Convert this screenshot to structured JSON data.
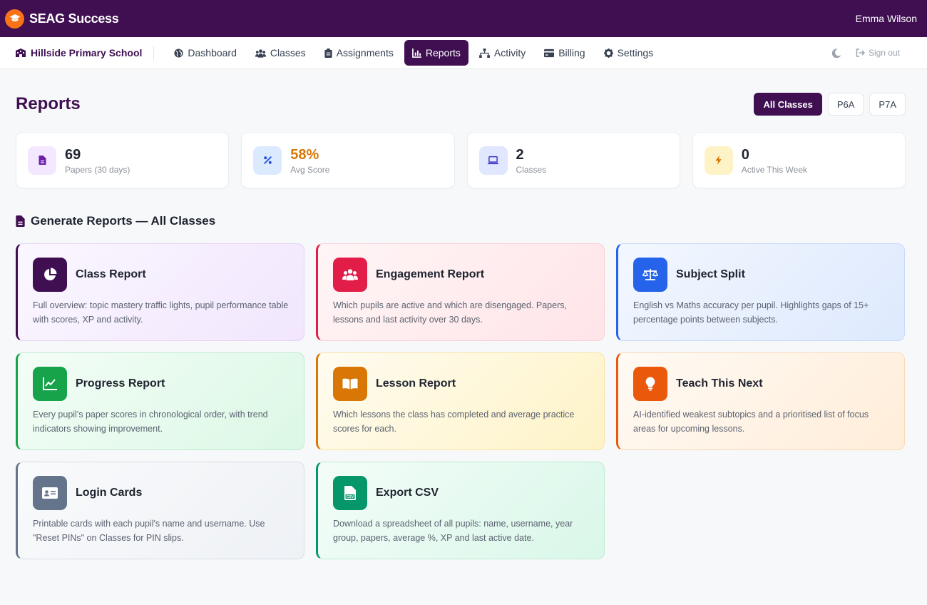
{
  "app": {
    "name": "SEAG Success",
    "user": "Emma Wilson"
  },
  "nav": {
    "school": "Hillside Primary School",
    "items": [
      {
        "label": "Dashboard",
        "icon": "globe-icon"
      },
      {
        "label": "Classes",
        "icon": "users-icon"
      },
      {
        "label": "Assignments",
        "icon": "clipboard-icon"
      },
      {
        "label": "Reports",
        "icon": "chart-icon",
        "active": true
      },
      {
        "label": "Activity",
        "icon": "network-icon"
      },
      {
        "label": "Billing",
        "icon": "card-icon"
      },
      {
        "label": "Settings",
        "icon": "gear-icon"
      }
    ],
    "signout": "Sign out"
  },
  "page": {
    "title": "Reports",
    "filters": [
      "All Classes",
      "P6A",
      "P7A"
    ],
    "active_filter": "All Classes"
  },
  "stats": [
    {
      "value": "69",
      "label": "Papers (30 days)",
      "icon": "document-icon",
      "color": "#6b21a8",
      "bg": "#f3e8ff"
    },
    {
      "value": "58%",
      "label": "Avg Score",
      "icon": "percent-icon",
      "color": "#1d4ed8",
      "bg": "#dbeafe",
      "value_color": "#d97706"
    },
    {
      "value": "2",
      "label": "Classes",
      "icon": "laptop-icon",
      "color": "#4338ca",
      "bg": "#e0e7ff"
    },
    {
      "value": "0",
      "label": "Active This Week",
      "icon": "bolt-icon",
      "color": "#d97706",
      "bg": "#fef3c7"
    }
  ],
  "section": {
    "title": "Generate Reports — All Classes"
  },
  "cards": [
    {
      "title": "Class Report",
      "desc": "Full overview: topic mastery traffic lights, pupil performance table with scores, XP and activity.",
      "icon": "pie-chart-icon",
      "accent": "#3f0f52",
      "bg1": "#fbf7ff",
      "bg2": "#f1e6fd",
      "border": "#e5d4f5"
    },
    {
      "title": "Engagement Report",
      "desc": "Which pupils are active and which are disengaged. Papers, lessons and last activity over 30 days.",
      "icon": "users-icon",
      "accent": "#e11d48",
      "bg1": "#fff5f6",
      "bg2": "#ffe4e8",
      "border": "#fbcfd7"
    },
    {
      "title": "Subject Split",
      "desc": "English vs Maths accuracy per pupil. Highlights gaps of 15+ percentage points between subjects.",
      "icon": "scale-icon",
      "accent": "#2563eb",
      "bg1": "#f3f7ff",
      "bg2": "#dde9fd",
      "border": "#c7dafc"
    },
    {
      "title": "Progress Report",
      "desc": "Every pupil's paper scores in chronological order, with trend indicators showing improvement.",
      "icon": "trend-icon",
      "accent": "#16a34a",
      "bg1": "#f3fdf6",
      "bg2": "#dcf8e6",
      "border": "#bfeccf"
    },
    {
      "title": "Lesson Report",
      "desc": "Which lessons the class has completed and average practice scores for each.",
      "icon": "book-icon",
      "accent": "#d97706",
      "bg1": "#fffcf0",
      "bg2": "#fef3c7",
      "border": "#fbe3a6"
    },
    {
      "title": "Teach This Next",
      "desc": "AI-identified weakest subtopics and a prioritised list of focus areas for upcoming lessons.",
      "icon": "lightbulb-icon",
      "accent": "#ea580c",
      "bg1": "#fffaf4",
      "bg2": "#ffedd9",
      "border": "#fbd9b8"
    },
    {
      "title": "Login Cards",
      "desc": "Printable cards with each pupil's name and username. Use \"Reset PINs\" on Classes for PIN slips.",
      "icon": "id-card-icon",
      "accent": "#64748b",
      "bg1": "#f9fafc",
      "bg2": "#eef1f5",
      "border": "#d8dde5"
    },
    {
      "title": "Export CSV",
      "desc": "Download a spreadsheet of all pupils: name, username, year group, papers, average %, XP and last active date.",
      "icon": "csv-file-icon",
      "accent": "#059669",
      "bg1": "#f3fdf8",
      "bg2": "#d9f7e9",
      "border": "#bfecd6"
    }
  ]
}
